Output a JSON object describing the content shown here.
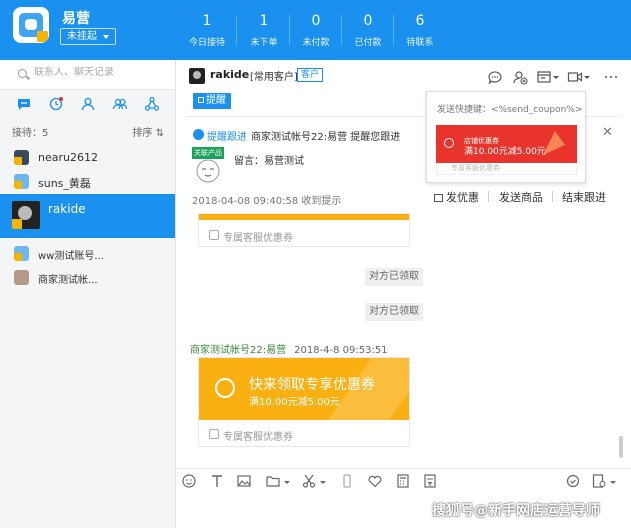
{
  "app": {
    "name": "易营"
  },
  "status": {
    "value": "未挂起"
  },
  "stats": [
    {
      "num": "1",
      "label": "今日接待"
    },
    {
      "num": "1",
      "label": "未下单"
    },
    {
      "num": "0",
      "label": "未付款"
    },
    {
      "num": "0",
      "label": "已付款"
    },
    {
      "num": "6",
      "label": "待联系"
    }
  ],
  "search": {
    "placeholder": "联系人、聊天记录"
  },
  "sidebar": {
    "receive_label": "接待：5",
    "sort_label": "排序",
    "contacts": [
      {
        "name": "nearu2612"
      },
      {
        "name": "suns_黄磊"
      },
      {
        "name": "rakide"
      },
      {
        "name": "ww测试账号..."
      },
      {
        "name": "商家测试帐..."
      }
    ]
  },
  "chat": {
    "name": "rakide",
    "tag": "[常用客户]",
    "pill": "客户",
    "reminder_button": "提醒"
  },
  "notification": {
    "title": "提醒跟进",
    "text": "商家测试帐号22:易营 提醒您跟进",
    "product_tag": "关联产品",
    "message": "留言：易营测试",
    "time": "2018-04-08 09:40:58 收到提示",
    "actions": [
      "发优惠",
      "发送商品",
      "结束跟进"
    ]
  },
  "coupon_popup": {
    "hint": "发送快捷键：<%send_coupon%>",
    "shop_label": "店铺优惠券",
    "amount": "满10.00元减5.00元",
    "footer": "专属客服优惠券"
  },
  "messages": {
    "stub_label": "专属客服优惠券",
    "system": [
      "对方已领取",
      "对方已领取"
    ],
    "sender": "商家测试帐号22:易营",
    "sender_time": "2018-4-8 09:53:51",
    "coupon_title": "快来领取专享优惠券",
    "coupon_amount": "满10.00元减5.00元",
    "coupon_label": "专属客服优惠券"
  },
  "watermark": "搜狐号@新手网店运营导师",
  "colors": {
    "primary": "#1a90ef",
    "coupon_orange": "#fbb012",
    "coupon_red": "#e8342c",
    "sender_green": "#3a8a3a"
  }
}
